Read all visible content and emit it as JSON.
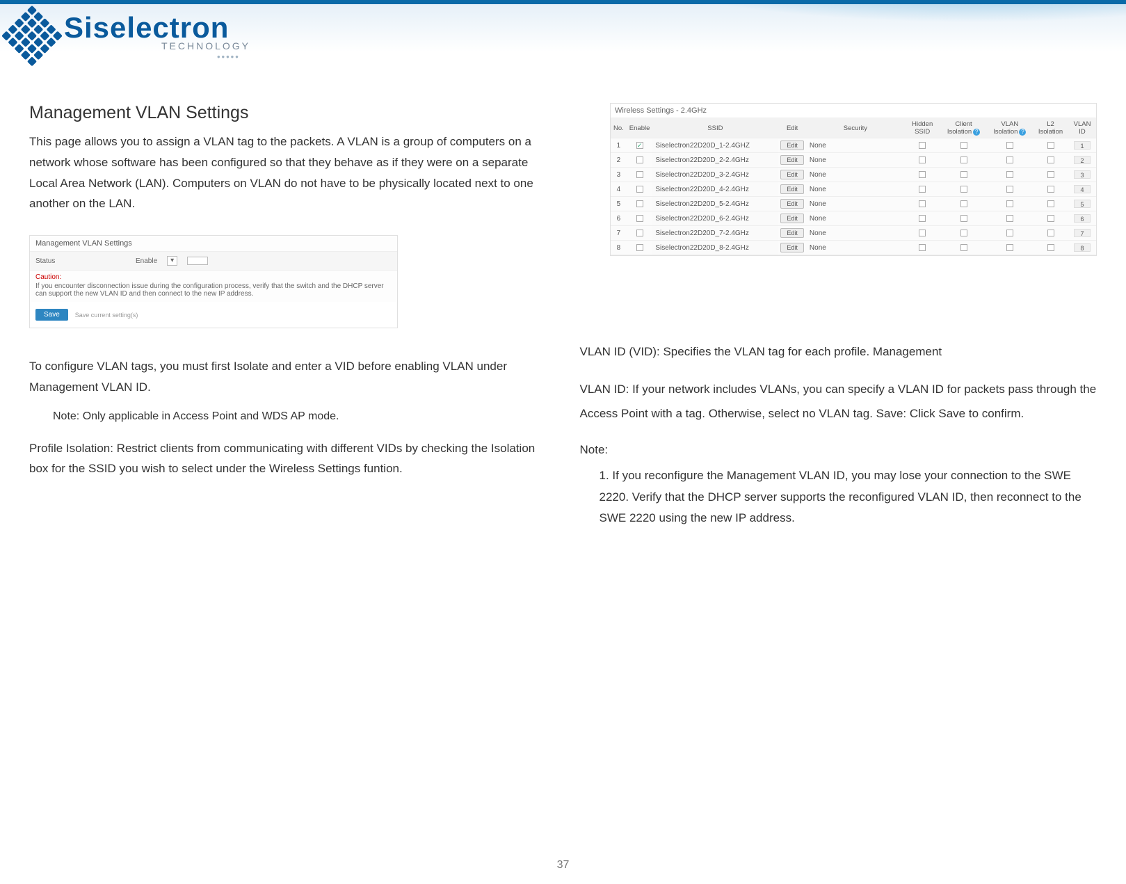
{
  "logo": {
    "brand": "Siselectron",
    "sub": "TECHNOLOGY",
    "dotsrow": "•••••"
  },
  "left": {
    "title": "Management VLAN Settings",
    "para1": "This page  allows  you  to  assign   a VLAN tag  to  the  packets. A VLAN is a group   of  computers  on  a  network  whose software has been configured  so that they  behave as if they  were  on a separate Local Area Network  (LAN). Computers  on VLAN do  not  have  to  be  physically located next  to  one  another on the  LAN.",
    "shot": {
      "header": "Management VLAN Settings",
      "status_label": "Status",
      "enable_label": "Enable",
      "select_value": "▾",
      "caution_label": "Caution:",
      "caution_text": "If you encounter disconnection issue during the configuration process, verify that the switch and the DHCP server can support the new VLAN ID and then connect to the new IP address.",
      "save_label": "Save",
      "save_hint": "Save current setting(s)"
    },
    "para2": "To configure VLAN tags,  you  must  first  Isolate  and  enter a VID before  enabling VLAN under  Management VLAN ID.",
    "note": "Note:  Only applicable  in Access  Point  and  WDS AP mode.",
    "para3": "Profile Isolation: Restrict  clients  from  communicating with different VIDs by  checking  the  Isolation  box  for  the   SSID you  wish  to  select under  the  Wireless  Settings funtion."
  },
  "right": {
    "table": {
      "caption": "Wireless Settings - 2.4GHz",
      "cols": [
        "No.",
        "Enable",
        "SSID",
        "Edit",
        "Security",
        "Hidden SSID",
        "Client Isolation",
        "VLAN Isolation",
        "L2 Isolation",
        "VLAN ID"
      ],
      "rows": [
        {
          "no": "1",
          "enable": true,
          "ssid": "Siselectron22D20D_1-2.4GHZ",
          "edit": "Edit",
          "security": "None",
          "vlan": "1"
        },
        {
          "no": "2",
          "enable": false,
          "ssid": "Siselectron22D20D_2-2.4GHz",
          "edit": "Edit",
          "security": "None",
          "vlan": "2"
        },
        {
          "no": "3",
          "enable": false,
          "ssid": "Siselectron22D20D_3-2.4GHz",
          "edit": "Edit",
          "security": "None",
          "vlan": "3"
        },
        {
          "no": "4",
          "enable": false,
          "ssid": "Siselectron22D20D_4-2.4GHz",
          "edit": "Edit",
          "security": "None",
          "vlan": "4"
        },
        {
          "no": "5",
          "enable": false,
          "ssid": "Siselectron22D20D_5-2.4GHz",
          "edit": "Edit",
          "security": "None",
          "vlan": "5"
        },
        {
          "no": "6",
          "enable": false,
          "ssid": "Siselectron22D20D_6-2.4GHz",
          "edit": "Edit",
          "security": "None",
          "vlan": "6"
        },
        {
          "no": "7",
          "enable": false,
          "ssid": "Siselectron22D20D_7-2.4GHz",
          "edit": "Edit",
          "security": "None",
          "vlan": "7"
        },
        {
          "no": "8",
          "enable": false,
          "ssid": "Siselectron22D20D_8-2.4GHz",
          "edit": "Edit",
          "security": "None",
          "vlan": "8"
        }
      ]
    },
    "para_vid": "VLAN ID (VID):  Specifies  the  VLAN tag  for each  profile. Management",
    "para_mgmt": "VLAN  ID: If  your  network  includes  VLANs, you  can  specify a  VLAN  ID for  packets pass   through  the Access  Point  with  a tag.  Otherwise, select  no  VLAN tag. Save:  Click Save  to  confirm.",
    "note_head": "Note:",
    "note_item": "1. If you  reconfigure the  Management VLAN ID, you  may lose  your connection to the SWE  2220. Verify that the DHCP server supports the reconfigured  VLAN ID,  then reconnect  to  the   SWE 2220 using the new IP address."
  },
  "pagenum": "37"
}
